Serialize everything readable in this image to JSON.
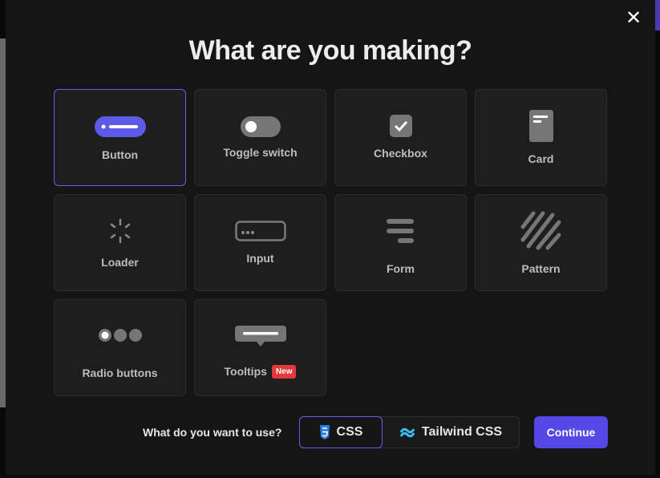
{
  "title": "What are you making?",
  "close_icon": "close-icon",
  "items": [
    {
      "label": "Button",
      "icon": "button-icon",
      "selected": true
    },
    {
      "label": "Toggle switch",
      "icon": "toggle-icon"
    },
    {
      "label": "Checkbox",
      "icon": "checkbox-icon"
    },
    {
      "label": "Card",
      "icon": "card-icon"
    },
    {
      "label": "Loader",
      "icon": "loader-icon"
    },
    {
      "label": "Input",
      "icon": "input-icon"
    },
    {
      "label": "Form",
      "icon": "form-icon"
    },
    {
      "label": "Pattern",
      "icon": "pattern-icon"
    },
    {
      "label": "Radio buttons",
      "icon": "radio-icon"
    },
    {
      "label": "Tooltips",
      "icon": "tooltip-icon",
      "badge": "New"
    }
  ],
  "footer": {
    "question": "What do you want to use?",
    "options": [
      {
        "label": "CSS",
        "selected": true
      },
      {
        "label": "Tailwind CSS"
      }
    ],
    "continue_label": "Continue"
  },
  "colors": {
    "accent": "#5546e6",
    "badge": "#e5383b",
    "css": "#2a7fe0",
    "tailwind": "#38bdf8"
  }
}
